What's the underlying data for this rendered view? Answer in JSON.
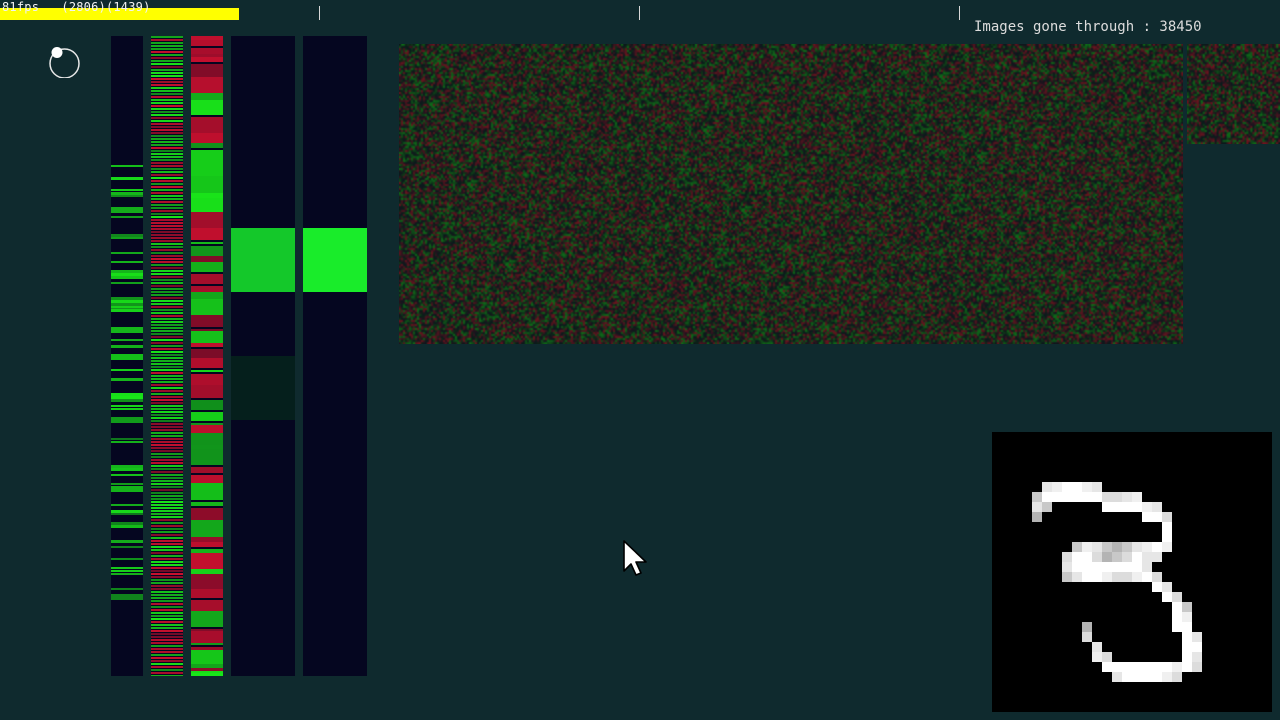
{
  "hud": {
    "fps_text": "81fps   (2806)(1439)",
    "images_label": "Images gone through : 38450"
  },
  "icons": {
    "knob": "dial-knob-icon",
    "cursor": "mouse-pointer-icon"
  },
  "colors": {
    "background": "#0f2a2e",
    "fps_bar": "#ffff00",
    "positive": "#19e619",
    "negative": "#c8102e",
    "layer_bg": "#050620",
    "digit_bg": "#000000"
  },
  "layers": [
    {
      "name": "input-activations"
    },
    {
      "name": "hidden-layer-1"
    },
    {
      "name": "hidden-layer-2"
    },
    {
      "name": "hidden-layer-3"
    },
    {
      "name": "output-layer"
    }
  ],
  "digit": {
    "label": "3"
  }
}
